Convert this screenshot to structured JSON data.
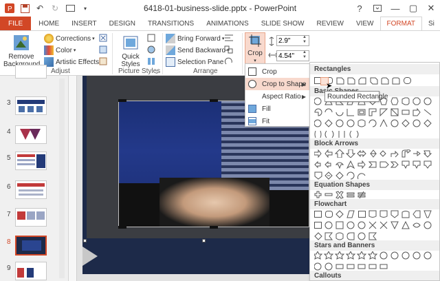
{
  "titlebar": {
    "doc_title": "6418-01-business-slide.pptx - PowerPoint",
    "help": "?",
    "minimize": "—",
    "maximize": "▢",
    "close": "✕"
  },
  "tabs": [
    {
      "label": "FILE"
    },
    {
      "label": "HOME"
    },
    {
      "label": "INSERT"
    },
    {
      "label": "DESIGN"
    },
    {
      "label": "TRANSITIONS"
    },
    {
      "label": "ANIMATIONS"
    },
    {
      "label": "SLIDE SHOW"
    },
    {
      "label": "REVIEW"
    },
    {
      "label": "VIEW"
    },
    {
      "label": "FORMAT"
    },
    {
      "label": "Si"
    }
  ],
  "ribbon": {
    "remove_background": "Remove Background",
    "corrections": "Corrections",
    "color": "Color",
    "artistic_effects": "Artistic Effects",
    "adjust_label": "Adjust",
    "quick_styles": "Quick Styles",
    "picture_styles_label": "Picture Styles",
    "bring_forward": "Bring Forward",
    "send_backward": "Send Backward",
    "selection_pane": "Selection Pane",
    "arrange_label": "Arrange",
    "crop": "Crop",
    "height_value": "2.9\"",
    "width_value": "4.54\""
  },
  "thumbnails": [
    {
      "num": "3"
    },
    {
      "num": "4"
    },
    {
      "num": "5"
    },
    {
      "num": "6"
    },
    {
      "num": "7"
    },
    {
      "num": "8"
    },
    {
      "num": "9"
    }
  ],
  "crop_menu": {
    "crop": "Crop",
    "crop_to_shape": "Crop to Shape",
    "aspect_ratio": "Aspect Ratio",
    "fill": "Fill",
    "fit": "Fit"
  },
  "gallery": {
    "rectangles": "Rectangles",
    "basic_shapes": "Basic Shapes",
    "block_arrows": "Block Arrows",
    "equation_shapes": "Equation Shapes",
    "flowchart": "Flowchart",
    "stars_and_banners": "Stars and Banners",
    "callouts": "Callouts",
    "tooltip": "Rounded Rectangle"
  },
  "colors": {
    "accent": "#d24726",
    "highlight": "#f8d9cd"
  }
}
